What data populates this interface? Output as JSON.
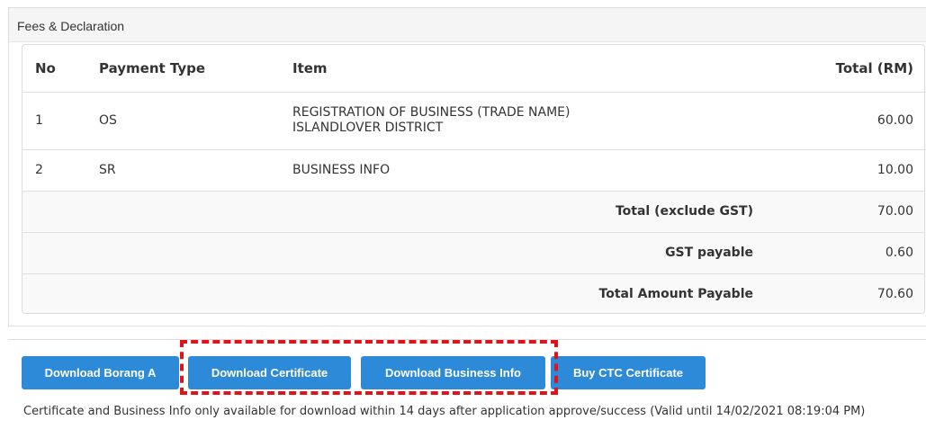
{
  "panel": {
    "title": "Fees & Declaration"
  },
  "table": {
    "headers": {
      "no": "No",
      "payment_type": "Payment Type",
      "item": "Item",
      "total": "Total (RM)"
    },
    "rows": [
      {
        "no": "1",
        "payment_type": "OS",
        "item_lines": [
          "REGISTRATION OF BUSINESS (TRADE NAME)",
          "ISLANDLOVER DISTRICT"
        ],
        "total": "60.00"
      },
      {
        "no": "2",
        "payment_type": "SR",
        "item_lines": [
          "BUSINESS INFO"
        ],
        "total": "10.00"
      }
    ],
    "summary": [
      {
        "label": "Total (exclude GST)",
        "value": "70.00"
      },
      {
        "label": "GST payable",
        "value": "0.60"
      },
      {
        "label": "Total Amount Payable",
        "value": "70.60"
      }
    ]
  },
  "buttons": {
    "download_borang_a": "Download Borang A",
    "download_certificate": "Download Certificate",
    "download_business_info": "Download Business Info",
    "buy_ctc_certificate": "Buy CTC Certificate"
  },
  "note": "Certificate and Business Info only available for download within 14 days after application approve/success (Valid until 14/02/2021 08:19:04 PM)",
  "colors": {
    "button": "#2d8ad8",
    "highlight": "#e0131b"
  }
}
